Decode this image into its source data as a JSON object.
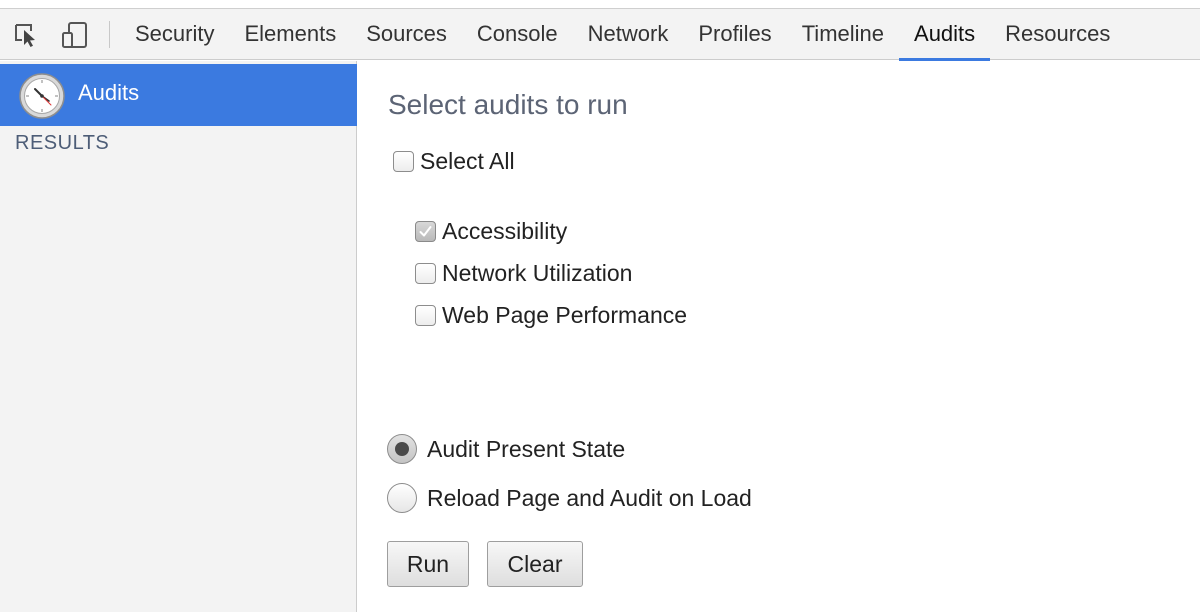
{
  "toolbar": {
    "icons": [
      "inspect-element-icon",
      "device-mode-icon"
    ],
    "tabs": [
      {
        "label": "Security"
      },
      {
        "label": "Elements"
      },
      {
        "label": "Sources"
      },
      {
        "label": "Console"
      },
      {
        "label": "Network"
      },
      {
        "label": "Profiles"
      },
      {
        "label": "Timeline"
      },
      {
        "label": "Audits",
        "active": true
      },
      {
        "label": "Resources"
      }
    ],
    "accent_color": "#3b7ae0"
  },
  "sidebar": {
    "selected_item": {
      "label": "Audits",
      "icon": "clock-icon"
    },
    "section_label": "RESULTS"
  },
  "main": {
    "heading": "Select audits to run",
    "select_all": {
      "label": "Select All",
      "checked": false
    },
    "audits": [
      {
        "label": "Accessibility",
        "checked": true
      },
      {
        "label": "Network Utilization",
        "checked": false
      },
      {
        "label": "Web Page Performance",
        "checked": false
      }
    ],
    "modes": [
      {
        "label": "Audit Present State",
        "selected": true
      },
      {
        "label": "Reload Page and Audit on Load",
        "selected": false
      }
    ],
    "buttons": {
      "run": "Run",
      "clear": "Clear"
    }
  }
}
